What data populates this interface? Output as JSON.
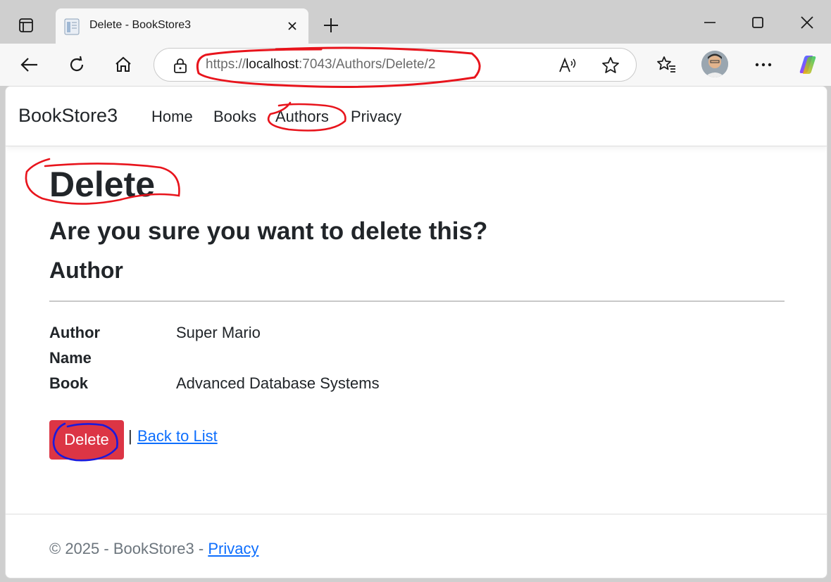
{
  "browser": {
    "tab": {
      "title": "Delete - BookStore3",
      "favicon": "page-icon"
    },
    "url": {
      "scheme": "https://",
      "host": "localhost",
      "rest": ":7043/Authors/Delete/2"
    },
    "icons": [
      "tab-actions-icon",
      "close-icon",
      "plus-icon",
      "minimize-icon",
      "maximize-icon",
      "window-close-icon",
      "back-arrow-icon",
      "refresh-icon",
      "home-icon",
      "lock-icon",
      "read-aloud-icon",
      "star-icon",
      "favorites-icon",
      "avatar",
      "more-icon",
      "copilot-icon"
    ]
  },
  "nav": {
    "brand": "BookStore3",
    "links": [
      "Home",
      "Books",
      "Authors",
      "Privacy"
    ]
  },
  "page": {
    "title": "Delete",
    "confirm": "Are you sure you want to delete this?",
    "entity": "Author",
    "fields": [
      {
        "label_line1": "Author",
        "label_line2": "Name",
        "value": "Super Mario"
      },
      {
        "label": "Book",
        "value": "Advanced Database Systems"
      }
    ],
    "delete_button": "Delete",
    "separator": "|",
    "back_link": "Back to List"
  },
  "footer": {
    "text": "© 2025 - BookStore3 - ",
    "privacy_link": "Privacy"
  },
  "colors": {
    "danger": "#dc3545",
    "link": "#0d6efd",
    "annotation_red": "#e8141c",
    "annotation_blue": "#1a1adc"
  }
}
